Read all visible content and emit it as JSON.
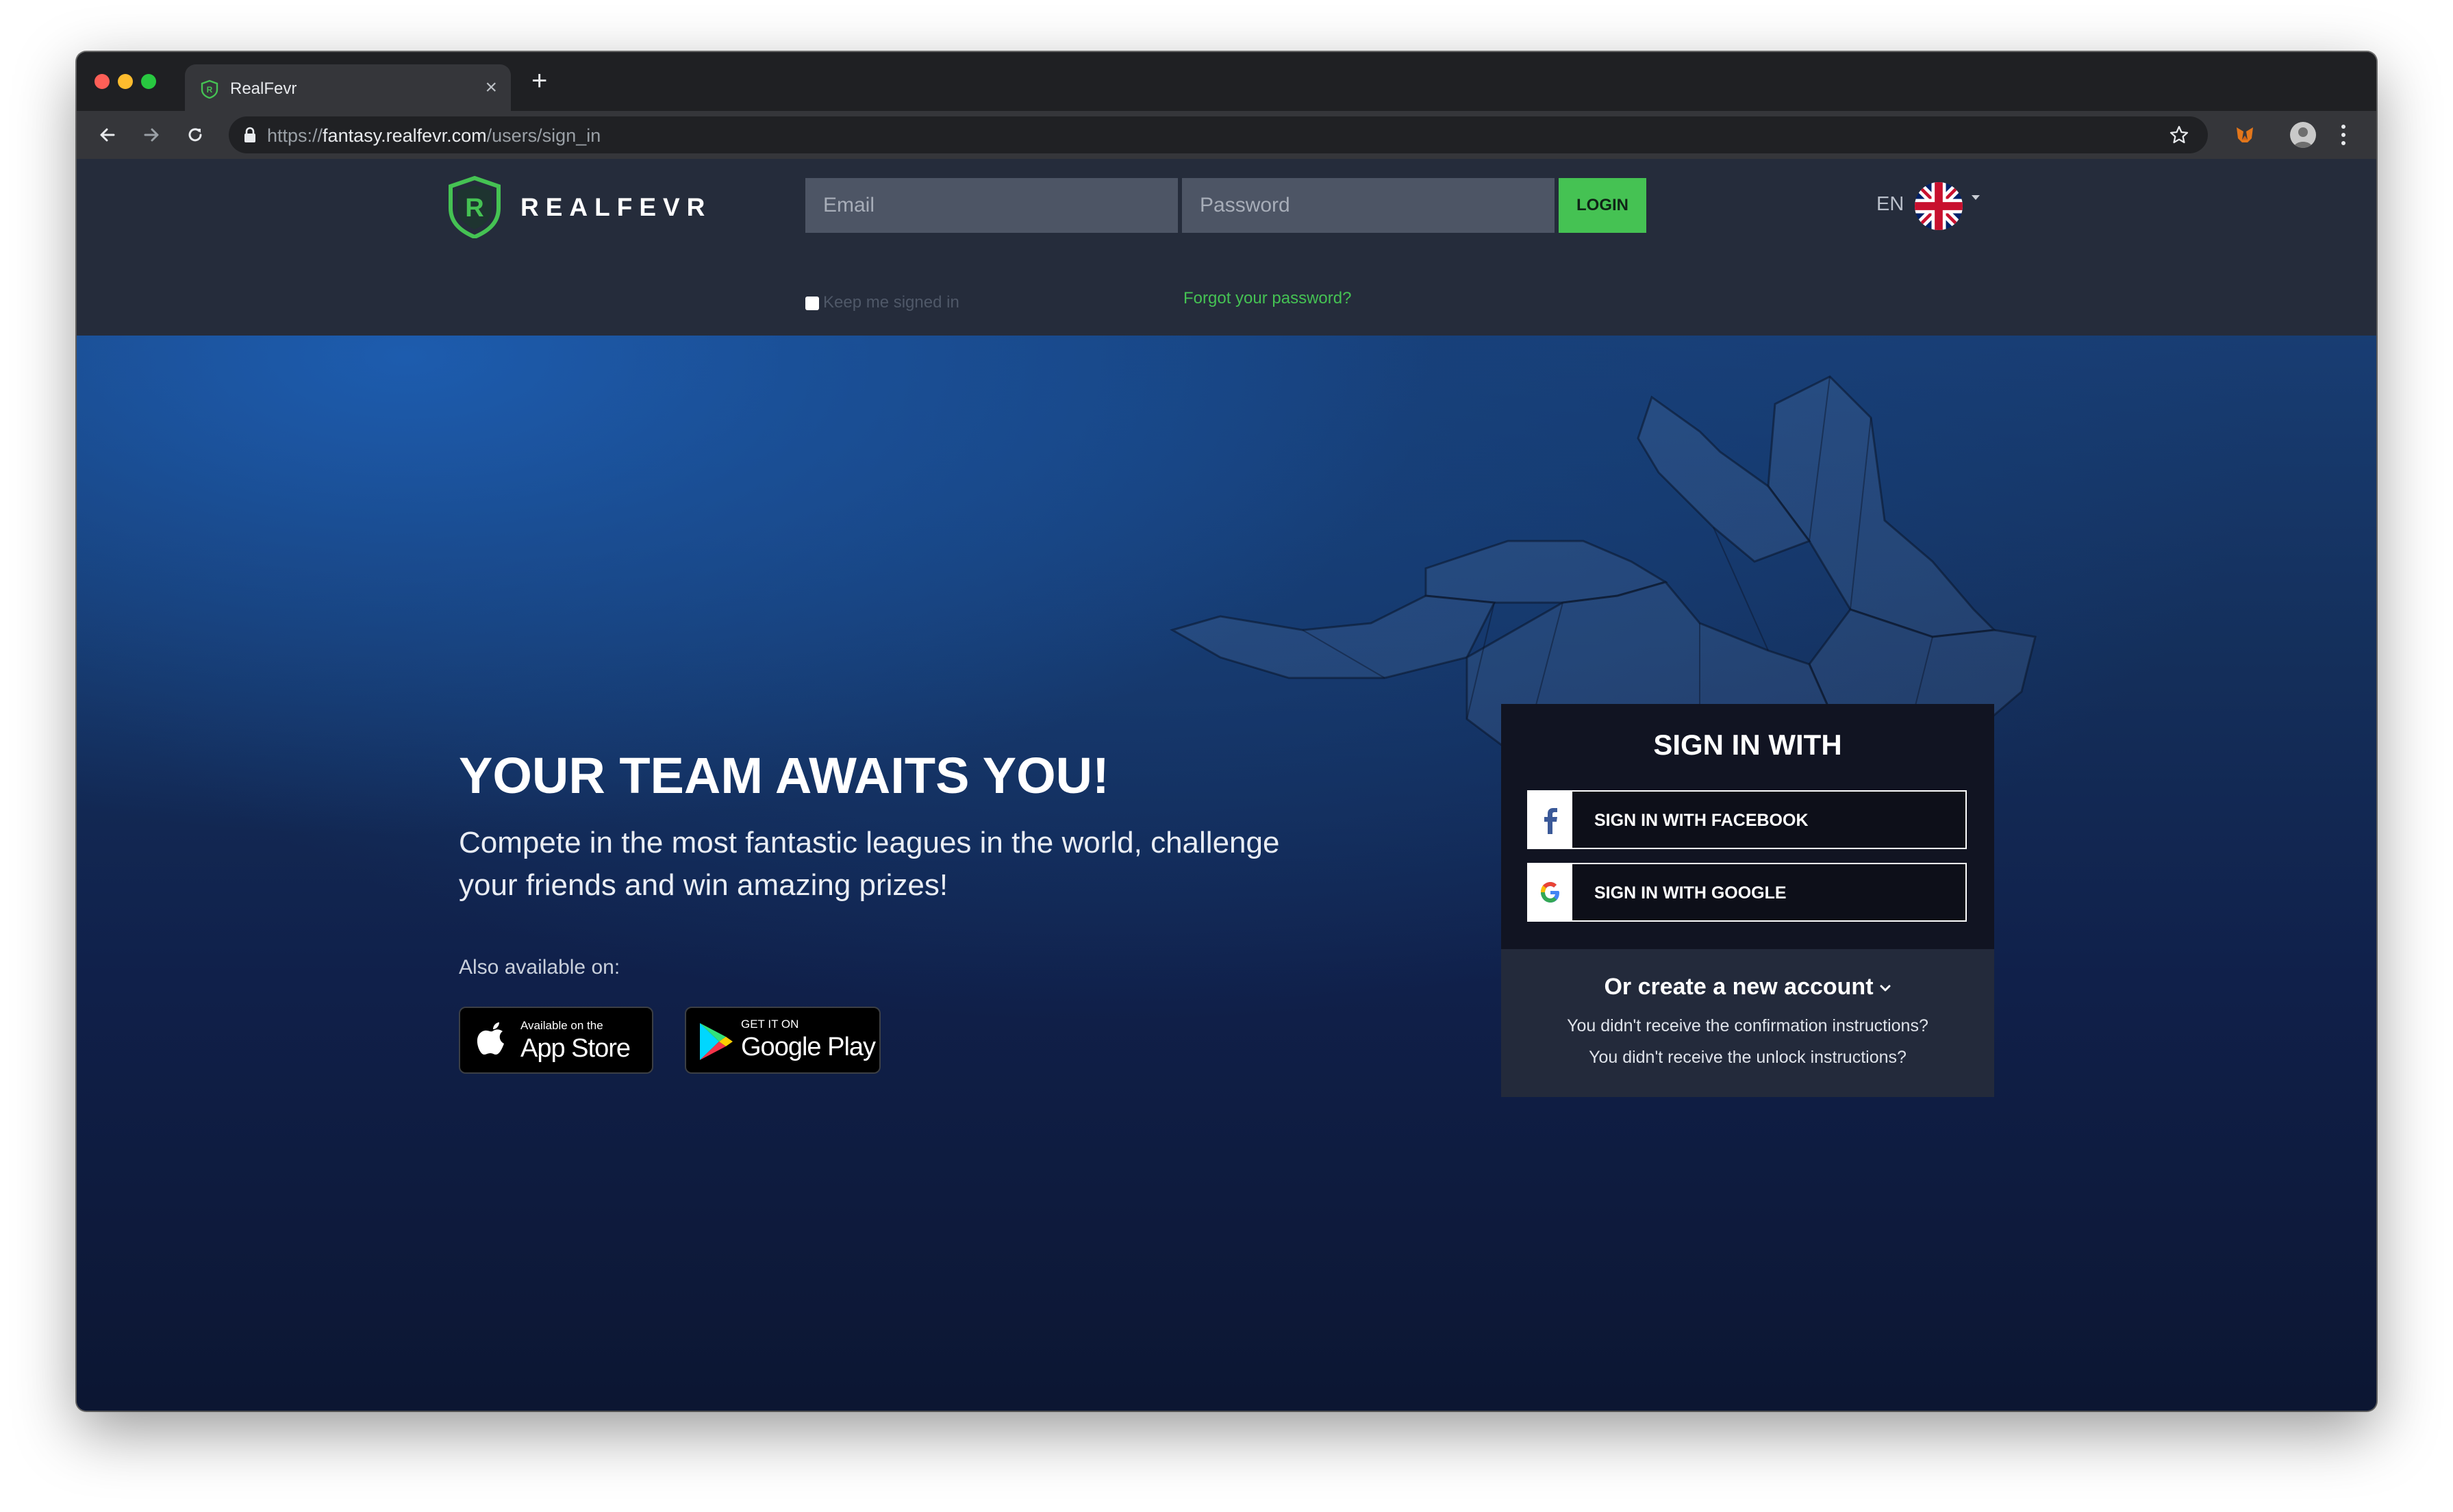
{
  "browser": {
    "tab_title": "RealFevr",
    "tab_close": "×",
    "new_tab": "+",
    "url_scheme": "https://",
    "url_host": "fantasy.realfevr.com",
    "url_path": "/users/sign_in"
  },
  "header": {
    "logo_text": "REALFEVR",
    "email_placeholder": "Email",
    "password_placeholder": "Password",
    "login_label": "LOGIN",
    "keep_signed_in": "Keep me signed in",
    "forgot_password": "Forgot your password?",
    "language": "EN"
  },
  "hero": {
    "headline": "YOUR TEAM AWAITS YOU!",
    "subline": "Compete in the most fantastic leagues in the world, challenge your friends and win amazing prizes!",
    "also_available": "Also available on:",
    "app_store": {
      "small": "Available on the",
      "big": "App Store"
    },
    "google_play": {
      "small": "GET IT ON",
      "big": "Google Play"
    }
  },
  "signin": {
    "title": "SIGN IN WITH",
    "facebook_label": "SIGN IN WITH FACEBOOK",
    "google_label": "SIGN IN WITH GOOGLE",
    "create_account": "Or create a new account",
    "confirmation_help": "You didn't receive the confirmation instructions?",
    "unlock_help": "You didn't receive the unlock instructions?"
  },
  "colors": {
    "accent_green": "#45c253",
    "header_bg": "#252c3b",
    "card_bg": "#111422"
  }
}
